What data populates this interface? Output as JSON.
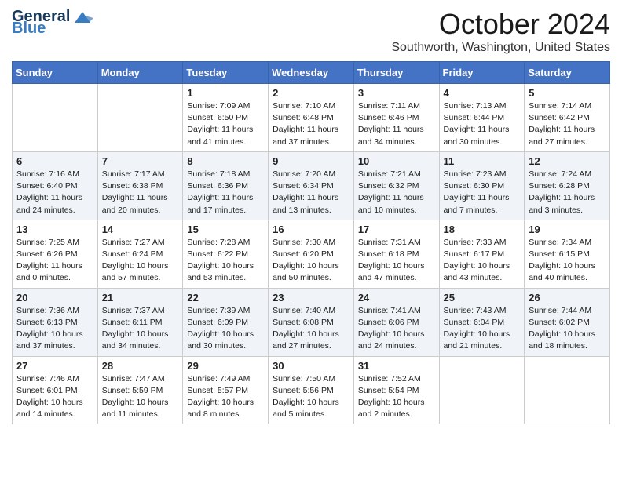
{
  "logo": {
    "general": "General",
    "blue": "Blue"
  },
  "header": {
    "month": "October 2024",
    "location": "Southworth, Washington, United States"
  },
  "weekdays": [
    "Sunday",
    "Monday",
    "Tuesday",
    "Wednesday",
    "Thursday",
    "Friday",
    "Saturday"
  ],
  "weeks": [
    [
      {
        "day": "",
        "info": ""
      },
      {
        "day": "",
        "info": ""
      },
      {
        "day": "1",
        "info": "Sunrise: 7:09 AM\nSunset: 6:50 PM\nDaylight: 11 hours and 41 minutes."
      },
      {
        "day": "2",
        "info": "Sunrise: 7:10 AM\nSunset: 6:48 PM\nDaylight: 11 hours and 37 minutes."
      },
      {
        "day": "3",
        "info": "Sunrise: 7:11 AM\nSunset: 6:46 PM\nDaylight: 11 hours and 34 minutes."
      },
      {
        "day": "4",
        "info": "Sunrise: 7:13 AM\nSunset: 6:44 PM\nDaylight: 11 hours and 30 minutes."
      },
      {
        "day": "5",
        "info": "Sunrise: 7:14 AM\nSunset: 6:42 PM\nDaylight: 11 hours and 27 minutes."
      }
    ],
    [
      {
        "day": "6",
        "info": "Sunrise: 7:16 AM\nSunset: 6:40 PM\nDaylight: 11 hours and 24 minutes."
      },
      {
        "day": "7",
        "info": "Sunrise: 7:17 AM\nSunset: 6:38 PM\nDaylight: 11 hours and 20 minutes."
      },
      {
        "day": "8",
        "info": "Sunrise: 7:18 AM\nSunset: 6:36 PM\nDaylight: 11 hours and 17 minutes."
      },
      {
        "day": "9",
        "info": "Sunrise: 7:20 AM\nSunset: 6:34 PM\nDaylight: 11 hours and 13 minutes."
      },
      {
        "day": "10",
        "info": "Sunrise: 7:21 AM\nSunset: 6:32 PM\nDaylight: 11 hours and 10 minutes."
      },
      {
        "day": "11",
        "info": "Sunrise: 7:23 AM\nSunset: 6:30 PM\nDaylight: 11 hours and 7 minutes."
      },
      {
        "day": "12",
        "info": "Sunrise: 7:24 AM\nSunset: 6:28 PM\nDaylight: 11 hours and 3 minutes."
      }
    ],
    [
      {
        "day": "13",
        "info": "Sunrise: 7:25 AM\nSunset: 6:26 PM\nDaylight: 11 hours and 0 minutes."
      },
      {
        "day": "14",
        "info": "Sunrise: 7:27 AM\nSunset: 6:24 PM\nDaylight: 10 hours and 57 minutes."
      },
      {
        "day": "15",
        "info": "Sunrise: 7:28 AM\nSunset: 6:22 PM\nDaylight: 10 hours and 53 minutes."
      },
      {
        "day": "16",
        "info": "Sunrise: 7:30 AM\nSunset: 6:20 PM\nDaylight: 10 hours and 50 minutes."
      },
      {
        "day": "17",
        "info": "Sunrise: 7:31 AM\nSunset: 6:18 PM\nDaylight: 10 hours and 47 minutes."
      },
      {
        "day": "18",
        "info": "Sunrise: 7:33 AM\nSunset: 6:17 PM\nDaylight: 10 hours and 43 minutes."
      },
      {
        "day": "19",
        "info": "Sunrise: 7:34 AM\nSunset: 6:15 PM\nDaylight: 10 hours and 40 minutes."
      }
    ],
    [
      {
        "day": "20",
        "info": "Sunrise: 7:36 AM\nSunset: 6:13 PM\nDaylight: 10 hours and 37 minutes."
      },
      {
        "day": "21",
        "info": "Sunrise: 7:37 AM\nSunset: 6:11 PM\nDaylight: 10 hours and 34 minutes."
      },
      {
        "day": "22",
        "info": "Sunrise: 7:39 AM\nSunset: 6:09 PM\nDaylight: 10 hours and 30 minutes."
      },
      {
        "day": "23",
        "info": "Sunrise: 7:40 AM\nSunset: 6:08 PM\nDaylight: 10 hours and 27 minutes."
      },
      {
        "day": "24",
        "info": "Sunrise: 7:41 AM\nSunset: 6:06 PM\nDaylight: 10 hours and 24 minutes."
      },
      {
        "day": "25",
        "info": "Sunrise: 7:43 AM\nSunset: 6:04 PM\nDaylight: 10 hours and 21 minutes."
      },
      {
        "day": "26",
        "info": "Sunrise: 7:44 AM\nSunset: 6:02 PM\nDaylight: 10 hours and 18 minutes."
      }
    ],
    [
      {
        "day": "27",
        "info": "Sunrise: 7:46 AM\nSunset: 6:01 PM\nDaylight: 10 hours and 14 minutes."
      },
      {
        "day": "28",
        "info": "Sunrise: 7:47 AM\nSunset: 5:59 PM\nDaylight: 10 hours and 11 minutes."
      },
      {
        "day": "29",
        "info": "Sunrise: 7:49 AM\nSunset: 5:57 PM\nDaylight: 10 hours and 8 minutes."
      },
      {
        "day": "30",
        "info": "Sunrise: 7:50 AM\nSunset: 5:56 PM\nDaylight: 10 hours and 5 minutes."
      },
      {
        "day": "31",
        "info": "Sunrise: 7:52 AM\nSunset: 5:54 PM\nDaylight: 10 hours and 2 minutes."
      },
      {
        "day": "",
        "info": ""
      },
      {
        "day": "",
        "info": ""
      }
    ]
  ]
}
